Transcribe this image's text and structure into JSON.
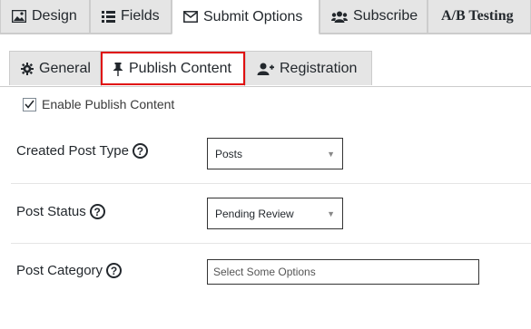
{
  "top_tabs": [
    {
      "label": "Design",
      "icon": "image-icon"
    },
    {
      "label": "Fields",
      "icon": "list-icon"
    },
    {
      "label": "Submit Options",
      "icon": "envelope-icon",
      "active": true
    },
    {
      "label": "Subscribe",
      "icon": "users-icon"
    },
    {
      "label": "A/B Testing",
      "icon": ""
    }
  ],
  "sub_tabs": [
    {
      "label": "General",
      "icon": "gear-icon"
    },
    {
      "label": "Publish Content",
      "icon": "pin-icon",
      "active": true
    },
    {
      "label": "Registration",
      "icon": "user-plus-icon"
    }
  ],
  "enable_label": "Enable Publish Content",
  "enable_checked": true,
  "fields": {
    "post_type": {
      "label": "Created Post Type",
      "value": "Posts"
    },
    "post_status": {
      "label": "Post Status",
      "value": "Pending Review"
    },
    "post_category": {
      "label": "Post Category",
      "placeholder": "Select Some Options"
    }
  },
  "help_glyph": "?",
  "highlight_color": "#e01010"
}
